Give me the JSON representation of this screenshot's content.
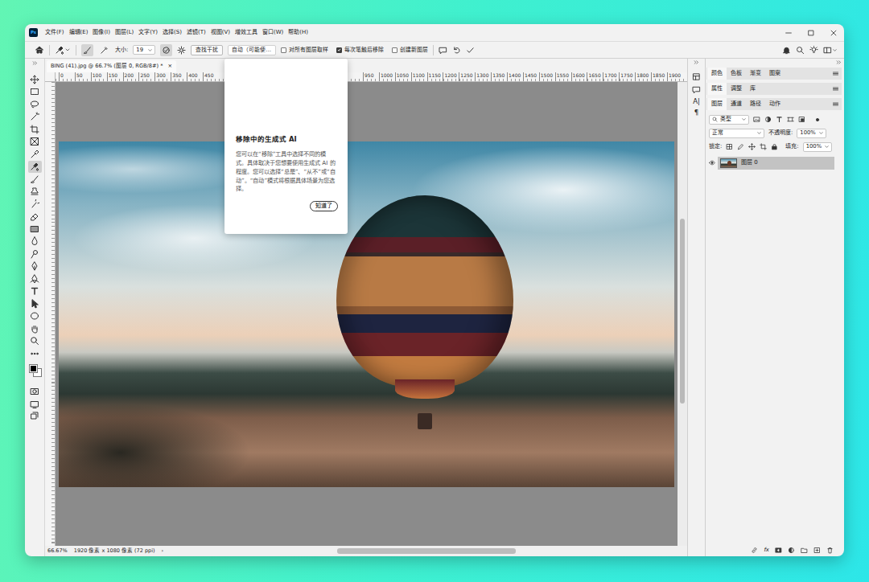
{
  "window": {
    "app_icon": "Ps"
  },
  "menu": [
    "文件(F)",
    "编辑(E)",
    "图像(I)",
    "图层(L)",
    "文字(Y)",
    "选择(S)",
    "滤镜(T)",
    "视图(V)",
    "增效工具",
    "窗口(W)",
    "帮助(H)"
  ],
  "options_bar": {
    "brush_modes": [
      {
        "selected": true
      },
      {
        "selected": false
      }
    ],
    "size_label": "大小:",
    "size_value": "19",
    "pressure_toggle": {
      "on": true
    },
    "find_button": "查找干扰",
    "mode_dropdown": "自动（可能使…",
    "checkboxes": [
      {
        "label": "对所有图层取样",
        "checked": false
      },
      {
        "label": "每次笔触后移除",
        "checked": true
      },
      {
        "label": "创建新图层",
        "checked": false
      }
    ]
  },
  "document_tab": {
    "title": "BING (41).jpg @ 66.7% (图层 0, RGB/8#) *",
    "close": "×"
  },
  "ruler": {
    "left": [
      "0",
      "50",
      "100",
      "150",
      "200",
      "250",
      "300",
      "350",
      "400",
      "450"
    ],
    "right": [
      "950",
      "1000",
      "1050",
      "1100",
      "1150",
      "1200",
      "1250",
      "1300",
      "1350",
      "1400",
      "1450",
      "1500",
      "1550",
      "1600",
      "1650",
      "1700",
      "1750",
      "1800",
      "1850",
      "1900"
    ]
  },
  "tools": [
    {
      "selected": false
    },
    {
      "selected": false
    },
    {
      "selected": false
    },
    {
      "selected": false
    },
    {
      "selected": false
    },
    {
      "selected": false
    },
    {
      "selected": false
    },
    {
      "selected": true
    },
    {
      "selected": false
    },
    {
      "selected": false
    },
    {
      "selected": false
    },
    {
      "selected": false
    },
    {
      "selected": false
    },
    {
      "selected": false
    },
    {
      "selected": false
    },
    {
      "selected": false
    },
    {
      "selected": false
    },
    {
      "selected": false
    },
    {
      "selected": false
    },
    {
      "selected": false
    },
    {
      "selected": false
    },
    {
      "selected": false
    }
  ],
  "popover": {
    "title": "移除中的生成式 AI",
    "body": "您可以在“移除”工具中选择不同的模式。具体取决于您想要使用生成式 AI 的程度。您可以选择“总是”、“从不”或“自动”。“自动”模式将根据具体场景为您选择。",
    "button": "知道了"
  },
  "icon_strip": {
    "chars": [
      "A|",
      "¶"
    ]
  },
  "panel_groups": [
    {
      "tabs": [
        {
          "label": "颜色",
          "selected": true
        },
        {
          "label": "色板",
          "selected": false
        },
        {
          "label": "渐变",
          "selected": false
        },
        {
          "label": "图案",
          "selected": false
        }
      ]
    },
    {
      "tabs": [
        {
          "label": "属性",
          "selected": true
        },
        {
          "label": "调整",
          "selected": false
        },
        {
          "label": "库",
          "selected": false
        }
      ]
    },
    {
      "tabs": [
        {
          "label": "图层",
          "selected": true
        },
        {
          "label": "通道",
          "selected": false
        },
        {
          "label": "路径",
          "selected": false
        },
        {
          "label": "动作",
          "selected": false
        }
      ]
    }
  ],
  "layers": {
    "filter": "类型",
    "blend_mode": "正常",
    "opacity_label": "不透明度:",
    "opacity": "100%",
    "lock_label": "锁定:",
    "fill_label": "填充:",
    "fill": "100%",
    "fx": "fx",
    "items": [
      {
        "name": "图层 0",
        "visible": true,
        "selected": true
      }
    ]
  },
  "status_bar": {
    "zoom": "66.67%",
    "info": "1920 像素 x 1080 像素 (72 ppi)",
    "arrow": "›"
  }
}
